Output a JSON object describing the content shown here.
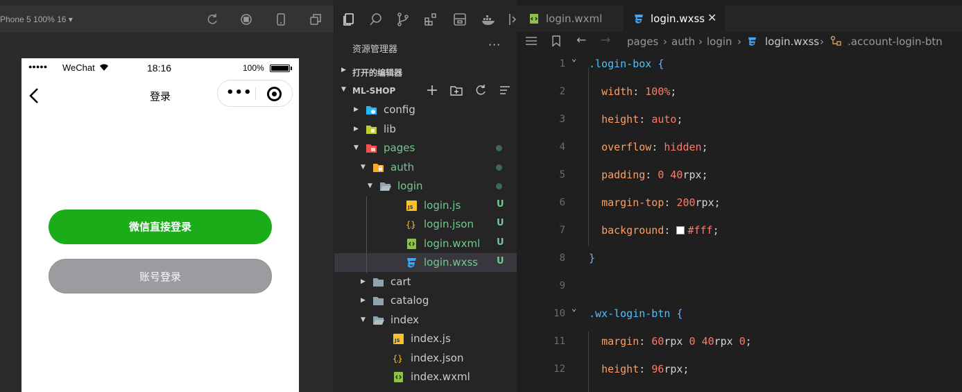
{
  "simulator": {
    "device": "Phone 5 100% 16 ▾",
    "status": {
      "signal": "●●●●●",
      "carrier": "WeChat",
      "time": "18:16",
      "battery": "100%"
    },
    "nav_title": "登录",
    "capsule_more": "•••",
    "buttons": {
      "wechat_login": "微信直接登录",
      "account_login": "账号登录"
    }
  },
  "explorer": {
    "title": "资源管理器",
    "more": "···",
    "open_editors": "打开的编辑器",
    "project": "ML-SHOP",
    "tree": [
      {
        "name": "config",
        "depth": 0,
        "kind": "folder-config",
        "open": false
      },
      {
        "name": "lib",
        "depth": 0,
        "kind": "folder-lib",
        "open": false
      },
      {
        "name": "pages",
        "depth": 0,
        "kind": "folder-pages",
        "open": true,
        "modified": true
      },
      {
        "name": "auth",
        "depth": 1,
        "kind": "folder-auth",
        "open": true,
        "modified": true
      },
      {
        "name": "login",
        "depth": 2,
        "kind": "folder-open",
        "open": true,
        "modified": true
      },
      {
        "name": "login.js",
        "depth": 3,
        "kind": "js",
        "status": "U"
      },
      {
        "name": "login.json",
        "depth": 3,
        "kind": "json",
        "status": "U"
      },
      {
        "name": "login.wxml",
        "depth": 3,
        "kind": "wxml",
        "status": "U"
      },
      {
        "name": "login.wxss",
        "depth": 3,
        "kind": "wxss",
        "status": "U",
        "selected": true
      },
      {
        "name": "cart",
        "depth": 1,
        "kind": "folder",
        "open": false
      },
      {
        "name": "catalog",
        "depth": 1,
        "kind": "folder",
        "open": false
      },
      {
        "name": "index",
        "depth": 1,
        "kind": "folder-open",
        "open": true
      },
      {
        "name": "index.js",
        "depth": 2,
        "kind": "js"
      },
      {
        "name": "index.json",
        "depth": 2,
        "kind": "json"
      },
      {
        "name": "index.wxml",
        "depth": 2,
        "kind": "wxml"
      }
    ]
  },
  "editor": {
    "tabs": [
      {
        "label": "login.wxml",
        "kind": "wxml",
        "active": false
      },
      {
        "label": "login.wxss",
        "kind": "wxss",
        "active": true,
        "close": "✕"
      }
    ],
    "breadcrumbs": {
      "pages": "pages",
      "auth": "auth",
      "login": "login",
      "file": "login.wxss",
      "symbol": ".account-login-btn"
    },
    "lines": [
      {
        "n": "1",
        "fold": true,
        "tokens": [
          [
            "sel-c",
            ".login-box"
          ],
          [
            "pun",
            " "
          ],
          [
            "brace",
            "{"
          ]
        ]
      },
      {
        "n": "2",
        "tokens": [
          [
            "pun",
            "  "
          ],
          [
            "prop",
            "width"
          ],
          [
            "pun",
            ": "
          ],
          [
            "val",
            "100%"
          ],
          [
            "pun",
            ";"
          ]
        ]
      },
      {
        "n": "3",
        "tokens": [
          [
            "pun",
            "  "
          ],
          [
            "prop",
            "height"
          ],
          [
            "pun",
            ": "
          ],
          [
            "val",
            "auto"
          ],
          [
            "pun",
            ";"
          ]
        ]
      },
      {
        "n": "4",
        "tokens": [
          [
            "pun",
            "  "
          ],
          [
            "prop",
            "overflow"
          ],
          [
            "pun",
            ": "
          ],
          [
            "val",
            "hidden"
          ],
          [
            "pun",
            ";"
          ]
        ]
      },
      {
        "n": "5",
        "tokens": [
          [
            "pun",
            "  "
          ],
          [
            "prop",
            "padding"
          ],
          [
            "pun",
            ": "
          ],
          [
            "num",
            "0"
          ],
          [
            "pun",
            " "
          ],
          [
            "num",
            "40"
          ],
          [
            "unit",
            "rpx"
          ],
          [
            "pun",
            ";"
          ]
        ]
      },
      {
        "n": "6",
        "tokens": [
          [
            "pun",
            "  "
          ],
          [
            "prop",
            "margin-top"
          ],
          [
            "pun",
            ": "
          ],
          [
            "num",
            "200"
          ],
          [
            "unit",
            "rpx"
          ],
          [
            "pun",
            ";"
          ]
        ]
      },
      {
        "n": "7",
        "tokens": [
          [
            "pun",
            "  "
          ],
          [
            "prop",
            "background"
          ],
          [
            "pun",
            ": "
          ],
          [
            "swatch",
            ""
          ],
          [
            "val",
            "#fff"
          ],
          [
            "pun",
            ";"
          ]
        ]
      },
      {
        "n": "8",
        "tokens": [
          [
            "brace",
            "}"
          ]
        ]
      },
      {
        "n": "9",
        "tokens": []
      },
      {
        "n": "10",
        "fold": true,
        "tokens": [
          [
            "sel-c",
            ".wx-login-btn"
          ],
          [
            "pun",
            " "
          ],
          [
            "brace",
            "{"
          ]
        ]
      },
      {
        "n": "11",
        "tokens": [
          [
            "pun",
            "  "
          ],
          [
            "prop",
            "margin"
          ],
          [
            "pun",
            ": "
          ],
          [
            "num",
            "60"
          ],
          [
            "unit",
            "rpx"
          ],
          [
            "pun",
            " "
          ],
          [
            "num",
            "0"
          ],
          [
            "pun",
            " "
          ],
          [
            "num",
            "40"
          ],
          [
            "unit",
            "rpx"
          ],
          [
            "pun",
            " "
          ],
          [
            "num",
            "0"
          ],
          [
            "pun",
            ";"
          ]
        ]
      },
      {
        "n": "12",
        "tokens": [
          [
            "pun",
            "  "
          ],
          [
            "prop",
            "height"
          ],
          [
            "pun",
            ": "
          ],
          [
            "num",
            "96"
          ],
          [
            "unit",
            "rpx"
          ],
          [
            "pun",
            ";"
          ]
        ]
      }
    ]
  },
  "colors": {
    "wechat_green": "#1aad19",
    "account_gray": "#9b9ba0",
    "git_untracked": "#73c991"
  }
}
